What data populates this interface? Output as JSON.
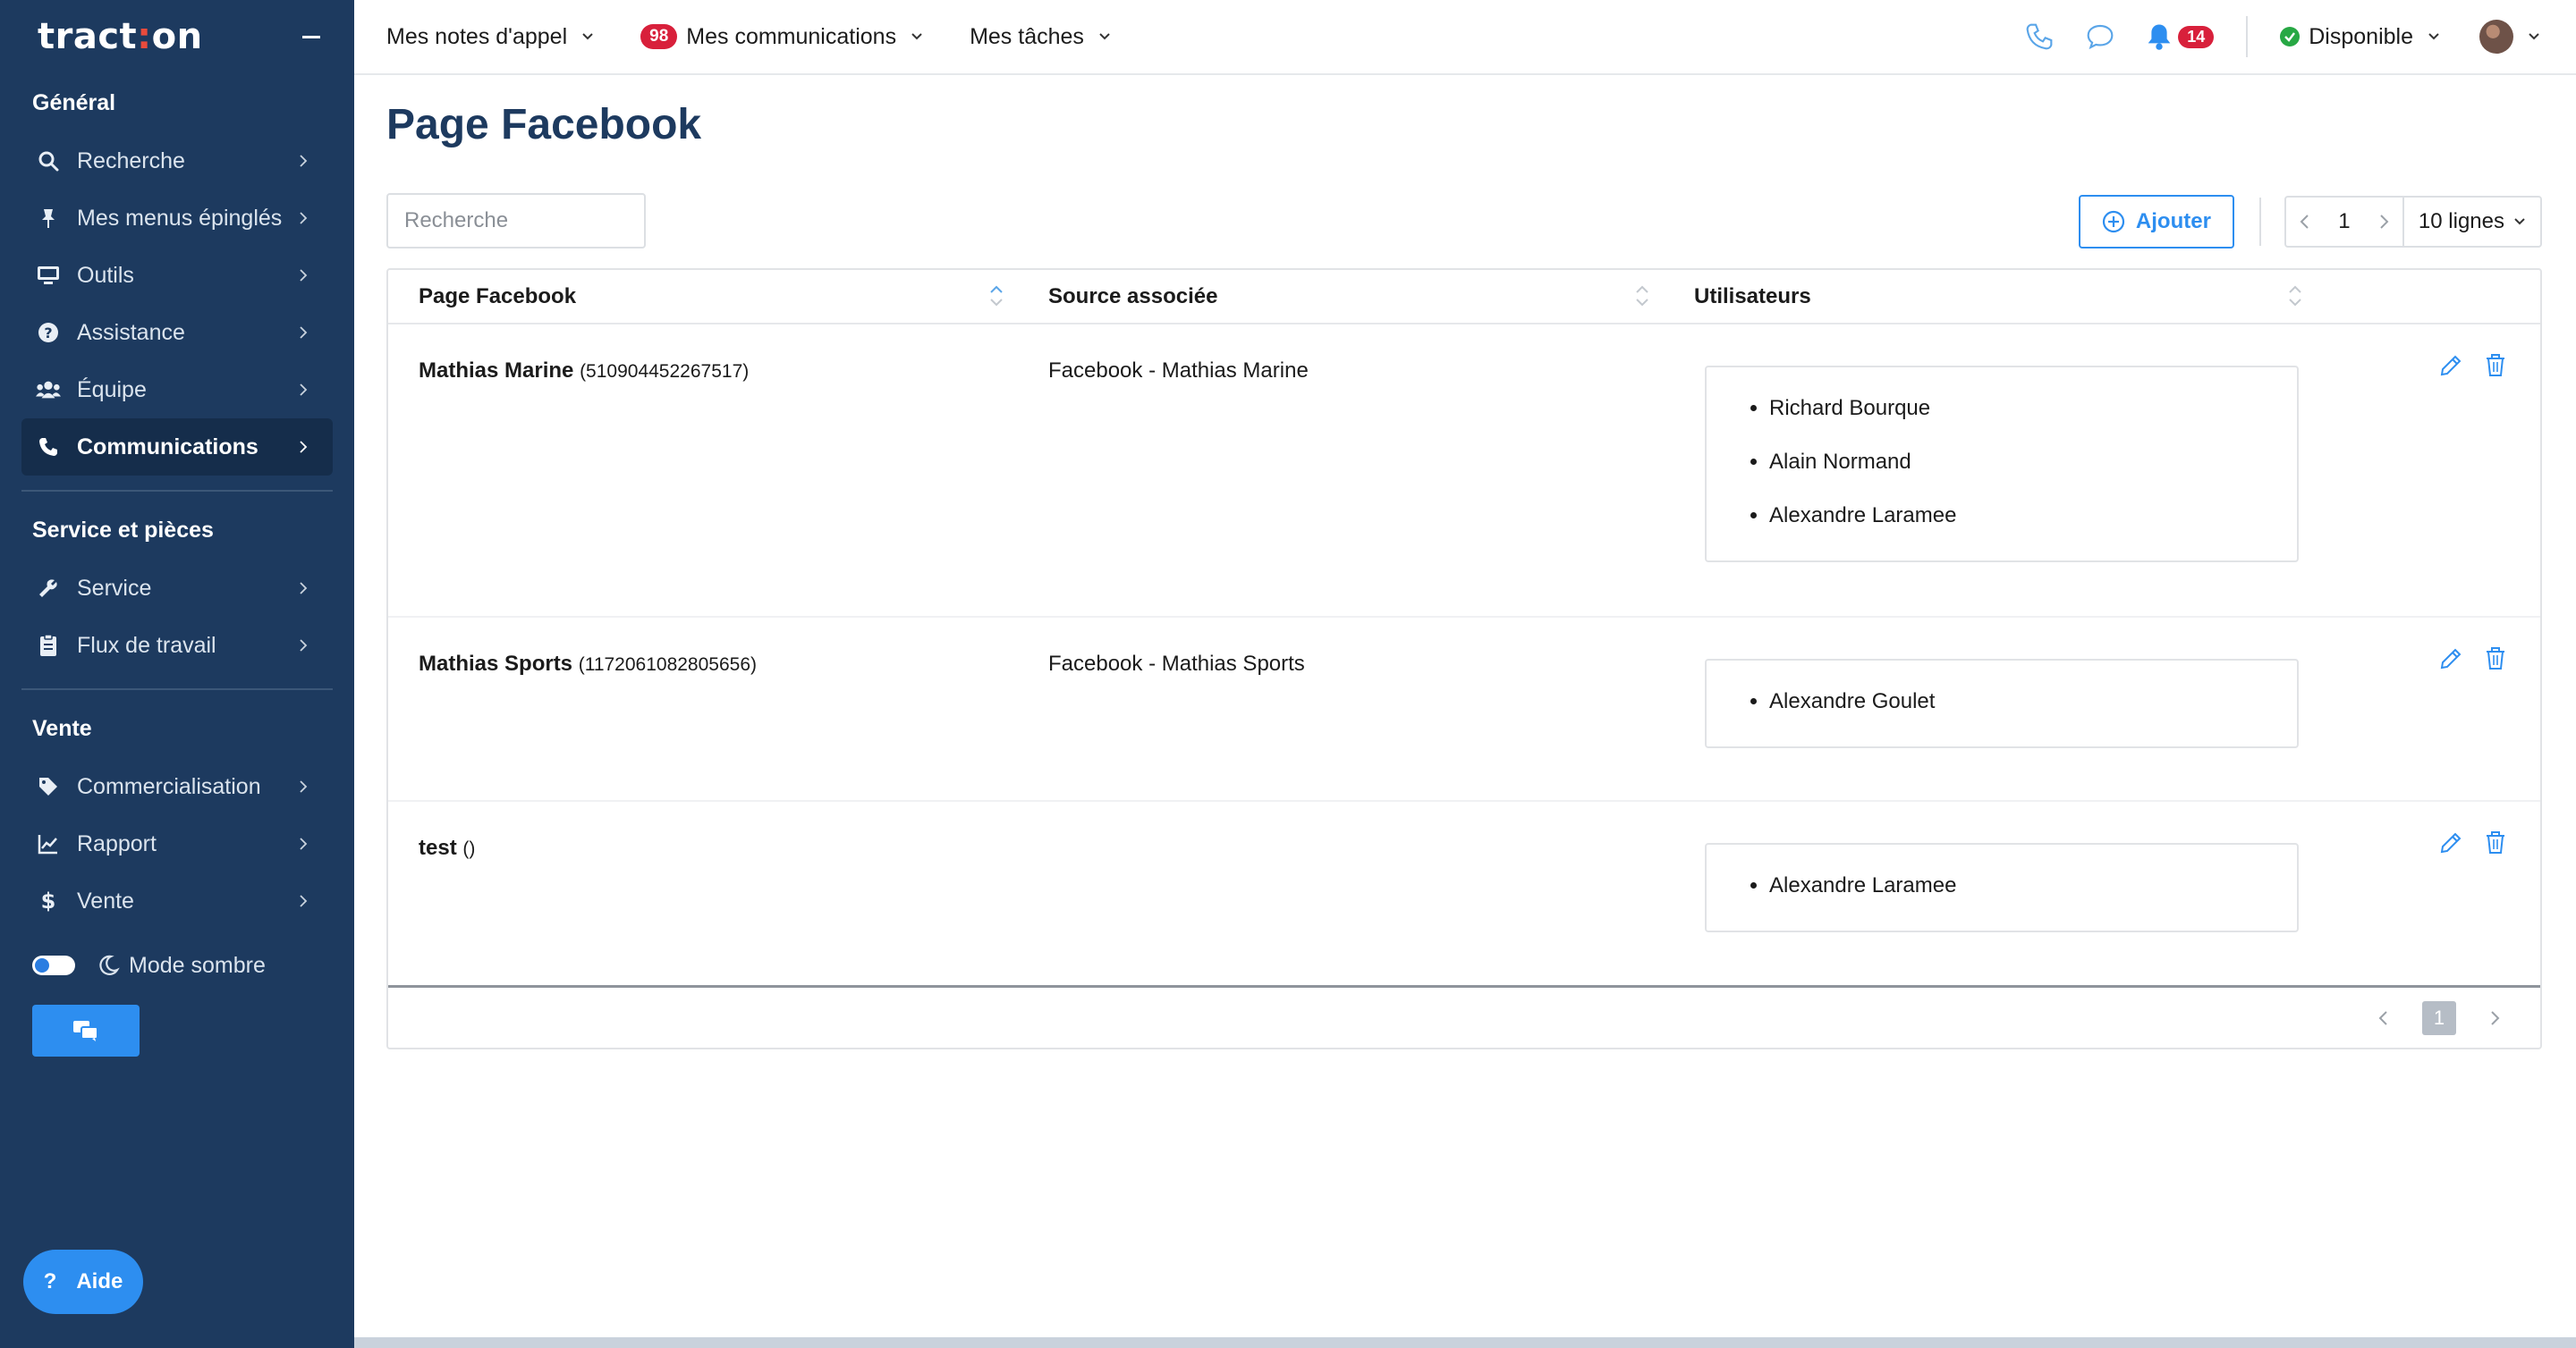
{
  "sidebar": {
    "logo": {
      "prefix": "tract",
      "dot": ":",
      "suffix": "on"
    },
    "sections": [
      {
        "title": "Général"
      },
      {
        "title": "Service et pièces"
      },
      {
        "title": "Vente"
      }
    ],
    "general_items": [
      {
        "label": "Recherche",
        "icon": "search-icon"
      },
      {
        "label": "Mes menus épinglés",
        "icon": "pin-icon"
      },
      {
        "label": "Outils",
        "icon": "monitor-icon"
      },
      {
        "label": "Assistance",
        "icon": "question-icon"
      },
      {
        "label": "Équipe",
        "icon": "users-icon"
      },
      {
        "label": "Communications",
        "icon": "phone-icon",
        "active": true
      }
    ],
    "service_items": [
      {
        "label": "Service",
        "icon": "wrench-icon"
      },
      {
        "label": "Flux de travail",
        "icon": "clipboard-icon"
      }
    ],
    "vente_items": [
      {
        "label": "Commercialisation",
        "icon": "tag-icon"
      },
      {
        "label": "Rapport",
        "icon": "chart-icon"
      },
      {
        "label": "Vente",
        "icon": "dollar-icon"
      }
    ],
    "dark_mode_label": "Mode sombre",
    "help_label": "Aide"
  },
  "topbar": {
    "menus": [
      {
        "label": "Mes notes d'appel"
      },
      {
        "label": "Mes communications",
        "badge": "98"
      },
      {
        "label": "Mes tâches"
      }
    ],
    "notifications_badge": "14",
    "status_label": "Disponible",
    "accent": "#2d8ef0",
    "badge_color": "#d8203b"
  },
  "main": {
    "title": "Page Facebook",
    "search_placeholder": "Recherche",
    "add_label": "Ajouter",
    "current_page": "1",
    "rows_label": "10 lignes",
    "columns": [
      "Page Facebook",
      "Source associée",
      "Utilisateurs"
    ],
    "rows": [
      {
        "name": "Mathias Marine",
        "id": "(510904452267517)",
        "source": "Facebook - Mathias Marine",
        "users": [
          "Richard Bourque",
          "Alain Normand",
          "Alexandre Laramee"
        ]
      },
      {
        "name": "Mathias Sports",
        "id": "(1172061082805656)",
        "source": "Facebook - Mathias Sports",
        "users": [
          "Alexandre Goulet"
        ]
      },
      {
        "name": "test",
        "id": "()",
        "source": "",
        "users": [
          "Alexandre Laramee"
        ]
      }
    ],
    "footer_page": "1"
  }
}
